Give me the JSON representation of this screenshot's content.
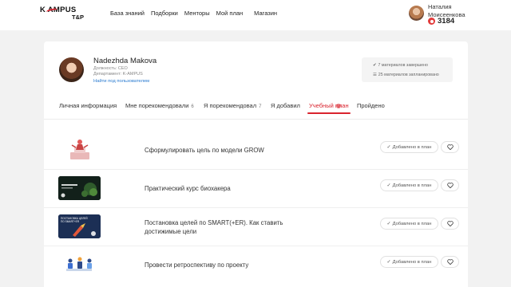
{
  "logo": {
    "line1": "K   AMPUS",
    "line2": "T&P"
  },
  "nav": {
    "items": [
      "База знаний",
      "Подборки",
      "Менторы",
      "Мой план",
      "Магазин"
    ]
  },
  "user": {
    "first_name": "Наталия",
    "last_name": "Моисеенкова",
    "coins": "3184"
  },
  "profile": {
    "name": "Nadezhda Makova",
    "position": "Должность: CEO",
    "department": "Департамент: K-AMPUS",
    "link": "Найти под пользователем"
  },
  "stats": {
    "completed": "7 материалов завершено",
    "planned": "25 материалов запланировано"
  },
  "tabs": [
    {
      "label": "Личная информация",
      "count": ""
    },
    {
      "label": "Мне порекомендовали",
      "count": "6"
    },
    {
      "label": "Я порекомендовал",
      "count": "7"
    },
    {
      "label": "Я добавил",
      "count": ""
    },
    {
      "label": "Учебный план",
      "count": ""
    },
    {
      "label": "Пройдено",
      "count": ""
    }
  ],
  "active_tab": "Учебный план",
  "rows": [
    {
      "title": "Сформулировать цель по модели GROW",
      "status": "Добавлено в план"
    },
    {
      "title": "Практический курс биохакера",
      "status": "Добавлено в план"
    },
    {
      "title": "Постановка целей по SMART(+ER). Как ставить достижимые цели",
      "status": "Добавлено в план",
      "thumb_text": "ПОСТАНОВКА ЦЕЛЕЙ ПО SMART+ER"
    },
    {
      "title": "Провести ретроспективу по проекту",
      "status": "Добавлено в план"
    }
  ],
  "colors": {
    "accent": "#d9232e",
    "link": "#2a7bd0",
    "background": "#f2f2f2"
  }
}
